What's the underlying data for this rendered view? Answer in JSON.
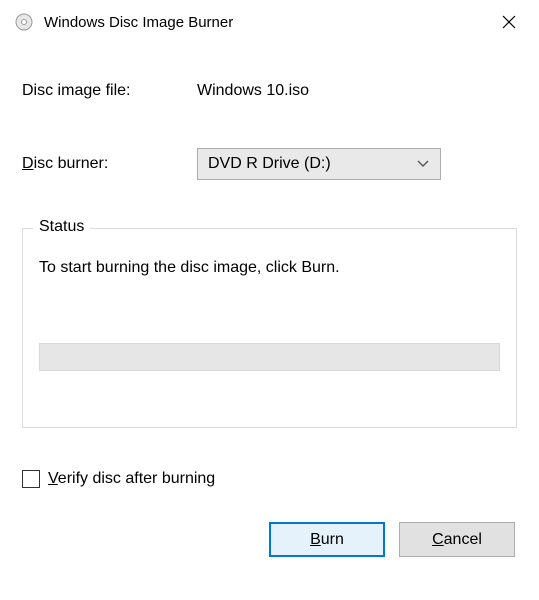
{
  "window": {
    "title": "Windows Disc Image Burner"
  },
  "form": {
    "disc_image_label": "Disc image file:",
    "disc_image_value": "Windows 10.iso",
    "disc_burner_label_pre": "D",
    "disc_burner_label_post": "isc burner:",
    "disc_burner_selected": "DVD R Drive (D:)"
  },
  "status": {
    "legend": "Status",
    "message": "To start burning the disc image, click Burn."
  },
  "verify": {
    "label_pre": "V",
    "label_post": "erify disc after burning",
    "checked": false
  },
  "buttons": {
    "burn_pre": "B",
    "burn_post": "urn",
    "cancel_pre": "C",
    "cancel_post": "ancel"
  }
}
